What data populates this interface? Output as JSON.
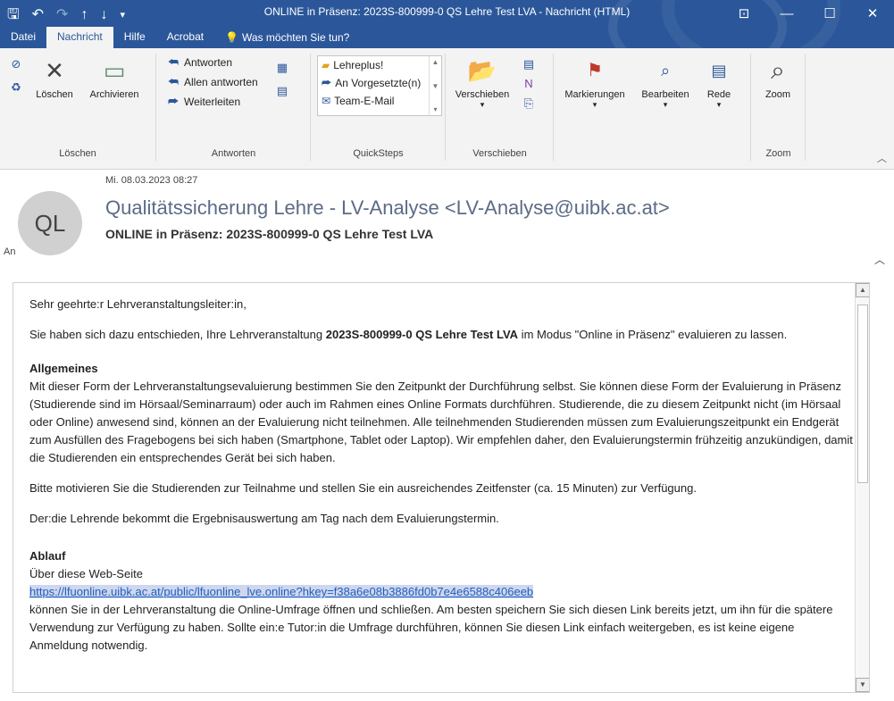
{
  "window": {
    "title": "ONLINE in Präsenz: 2023S-800999-0 QS Lehre Test LVA  -  Nachricht (HTML)"
  },
  "menu": {
    "tabs": [
      "Datei",
      "Nachricht",
      "Hilfe",
      "Acrobat"
    ],
    "active_tab": "Nachricht",
    "tell_me": "Was möchten Sie tun?"
  },
  "ribbon": {
    "delete": {
      "group_label": "Löschen",
      "delete_label": "Löschen",
      "archive_label": "Archivieren"
    },
    "respond": {
      "group_label": "Antworten",
      "reply": "Antworten",
      "reply_all": "Allen antworten",
      "forward": "Weiterleiten"
    },
    "quicksteps": {
      "group_label": "QuickSteps",
      "items": [
        "Lehreplus!",
        "An Vorgesetzte(n)",
        "Team-E-Mail"
      ]
    },
    "move": {
      "group_label": "Verschieben",
      "move_label": "Verschieben"
    },
    "tags": {
      "markierungen": "Markierungen",
      "bearbeiten": "Bearbeiten",
      "rede": "Rede"
    },
    "zoom": {
      "group_label": "Zoom",
      "zoom_label": "Zoom"
    }
  },
  "message": {
    "avatar_initials": "QL",
    "date": "Mi. 08.03.2023 08:27",
    "sender": "Qualitätssicherung Lehre - LV-Analyse <LV-Analyse@uibk.ac.at>",
    "subject": "ONLINE in Präsenz: 2023S-800999-0 QS Lehre Test LVA",
    "to_label": "An"
  },
  "body": {
    "greeting": "Sehr geehrte:r Lehrveranstaltungsleiter:in,",
    "intro_pre": "Sie haben sich dazu entschieden, Ihre Lehrveranstaltung ",
    "intro_bold": "2023S-800999-0 QS Lehre Test LVA",
    "intro_post": " im Modus \"Online in Präsenz\" evaluieren zu lassen.",
    "general_heading": "Allgemeines",
    "general_text": "Mit dieser Form der Lehrveranstaltungsevaluierung bestimmen Sie den Zeitpunkt der Durchführung selbst. Sie können diese Form der Evaluierung in Präsenz (Studierende sind im Hörsaal/Seminarraum) oder auch im Rahmen eines Online Formats durchführen. Studierende, die zu diesem Zeitpunkt nicht (im Hörsaal oder Online) anwesend sind, können an der Evaluierung nicht teilnehmen. Alle teilnehmenden Studierenden müssen zum Evaluierungszeitpunkt ein Endgerät zum Ausfüllen des Fragebogens bei sich haben (Smartphone, Tablet oder Laptop). Wir empfehlen daher, den Evaluierungstermin frühzeitig anzukündigen, damit die Studierenden ein entsprechendes Gerät bei sich haben.",
    "motivate": "Bitte motivieren Sie die Studierenden zur Teilnahme und stellen Sie ein ausreichendes Zeitfenster (ca. 15 Minuten) zur Verfügung.",
    "results": "Der:die Lehrende bekommt die Ergebnisauswertung am Tag nach dem Evaluierungstermin.",
    "process_heading": "Ablauf",
    "process_intro": "Über diese Web-Seite",
    "link": "https://lfuonline.uibk.ac.at/public/lfuonline_lve.online?hkey=f38a6e08b3886fd0b7e4e6588c406eeb",
    "process_text": "können Sie in der Lehrveranstaltung die Online-Umfrage öffnen und schließen. Am besten speichern Sie sich diesen Link bereits jetzt, um ihn für die spätere Verwendung zur Verfügung zu haben. Sollte ein:e Tutor:in die Umfrage durchführen, können Sie diesen Link einfach weitergeben, es ist keine eigene Anmeldung notwendig."
  },
  "icons": {
    "save": "save-icon",
    "undo": "undo-icon",
    "redo": "redo-icon",
    "up": "up-arrow-icon",
    "down": "down-arrow-icon",
    "ignore": "ignore-icon",
    "delete": "delete-icon",
    "archive": "archive-icon",
    "reply": "reply-icon",
    "move": "move-folder-icon",
    "flag": "flag-icon",
    "search": "search-icon",
    "zoom": "zoom-icon"
  },
  "colors": {
    "titlebar": "#2b579a",
    "ribbon": "#f3f3f3",
    "link": "#1f5fbf"
  }
}
